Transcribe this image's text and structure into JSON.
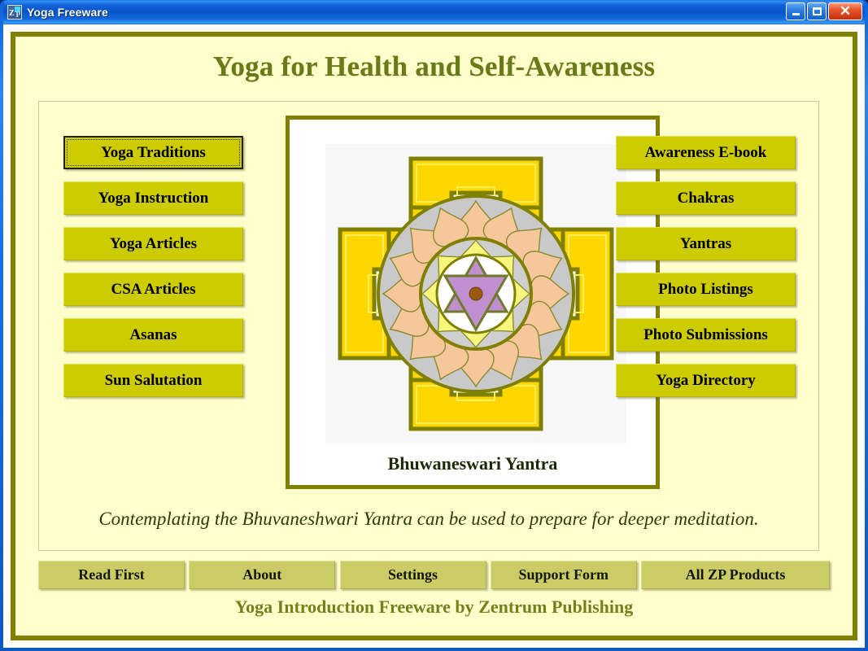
{
  "window": {
    "title": "Yoga Freeware",
    "icon": "app-icon",
    "minimize_label": "",
    "maximize_label": "",
    "close_label": "✕"
  },
  "header": {
    "title": "Yoga for Health and Self-Awareness"
  },
  "left_buttons": [
    {
      "label": "Yoga Traditions",
      "focused": true
    },
    {
      "label": "Yoga Instruction",
      "focused": false
    },
    {
      "label": "Yoga Articles",
      "focused": false
    },
    {
      "label": "CSA Articles",
      "focused": false
    },
    {
      "label": "Asanas",
      "focused": false
    },
    {
      "label": "Sun Salutation",
      "focused": false
    }
  ],
  "right_buttons": [
    {
      "label": "Awareness E-book"
    },
    {
      "label": "Chakras"
    },
    {
      "label": "Yantras"
    },
    {
      "label": "Photo Listings"
    },
    {
      "label": "Photo Submissions"
    },
    {
      "label": "Yoga Directory"
    }
  ],
  "yantra": {
    "caption": "Bhuwaneswari Yantra",
    "colors": {
      "bhupura_fill": "#ffd700",
      "outline": "#808000",
      "inner_line": "#f5e642",
      "outer_ring": "#c8c8c8",
      "petal_outer": "#f5c89a",
      "petal_inner": "#f7f77a",
      "hexagram": "#c08fd0",
      "center_dot": "#9a5b10",
      "disc": "#ffffff"
    }
  },
  "quote": {
    "text": "Contemplating the Bhuvaneshwari Yantra can be used to prepare for deeper meditation."
  },
  "bottom_buttons": [
    {
      "label": "Read First"
    },
    {
      "label": "About"
    },
    {
      "label": "Settings"
    },
    {
      "label": "Support Form"
    },
    {
      "label": "All ZP Products"
    }
  ],
  "footer": {
    "text": "Yoga Introduction Freeware by Zentrum Publishing"
  }
}
